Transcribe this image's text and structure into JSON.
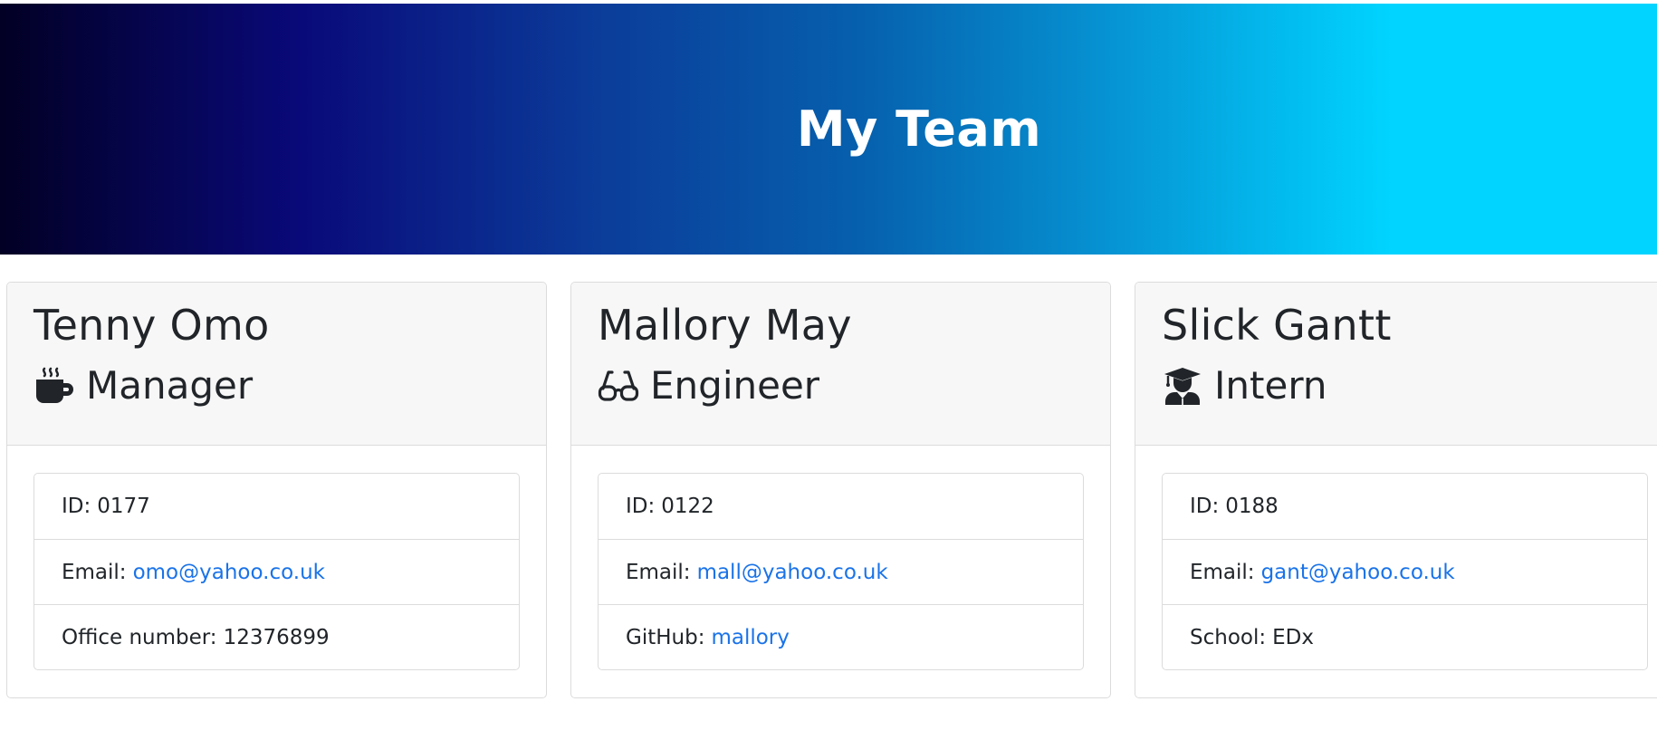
{
  "header": {
    "title": "My Team"
  },
  "colors": {
    "link": "#1a73e8",
    "header_bg": "#f7f7f7",
    "gradient_start": "#020024",
    "gradient_end": "#00d4ff"
  },
  "cards": [
    {
      "name": "Tenny Omo",
      "role": "Manager",
      "role_icon": "coffee-mug-icon",
      "id_label": "ID:",
      "id_value": "0177",
      "email_label": "Email:",
      "email_value": "omo@yahoo.co.uk",
      "extra_label": "Office number:",
      "extra_value": "12376899"
    },
    {
      "name": "Mallory May",
      "role": "Engineer",
      "role_icon": "glasses-icon",
      "id_label": "ID:",
      "id_value": "0122",
      "email_label": "Email:",
      "email_value": "mall@yahoo.co.uk",
      "extra_label": "GitHub:",
      "extra_value": "mallory"
    },
    {
      "name": "Slick Gantt",
      "role": "Intern",
      "role_icon": "graduate-icon",
      "id_label": "ID:",
      "id_value": "0188",
      "email_label": "Email:",
      "email_value": "gant@yahoo.co.uk",
      "extra_label": "School:",
      "extra_value": "EDx"
    }
  ]
}
